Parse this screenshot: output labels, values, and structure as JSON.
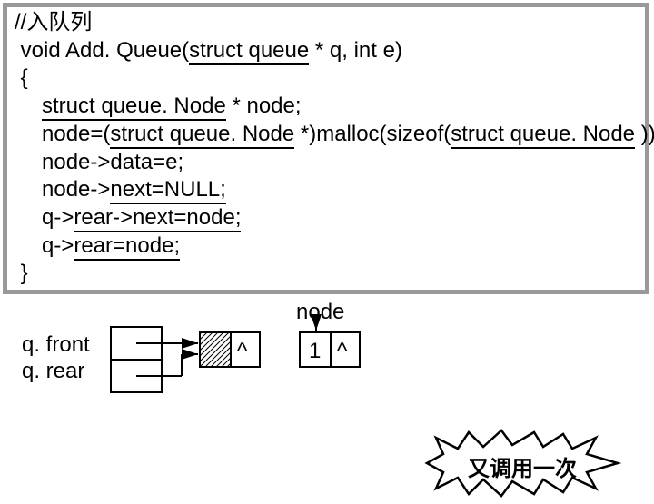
{
  "code": {
    "comment": "//入队列",
    "sig_pre": " void Add. Queue(",
    "sig_struct": "struct queue",
    "sig_post": " * q, int e)",
    "lbrace": " {",
    "decl_pre": "struct queue. Node",
    "decl_post": " * node;",
    "malloc_pre": "node=(",
    "malloc_struct1": "struct queue. Node",
    "malloc_mid": " *)malloc(sizeof(",
    "malloc_struct2": "struct queue. Node",
    "malloc_post": " ));",
    "line_data": "node->data=e;",
    "line_next_pre": "node->",
    "line_next_u": "next=NULL;",
    "line_rear_next_pre": "q->",
    "line_rear_next_u": "rear->next=node;",
    "line_rear_pre": "q->",
    "line_rear_u": "rear=node;",
    "rbrace": " }"
  },
  "labels": {
    "node": "node",
    "qfront": "q. front",
    "qrear": "q. rear",
    "one": "1",
    "caret1": "^",
    "caret2": "^",
    "starburst": "又调用一次"
  }
}
